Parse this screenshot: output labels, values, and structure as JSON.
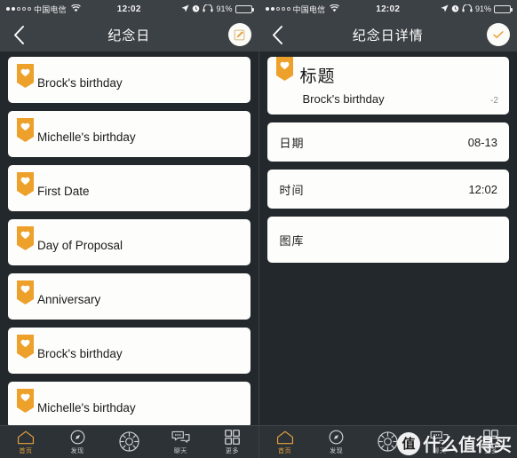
{
  "colors": {
    "background": "#23282c",
    "bar": "#3c4146",
    "card": "#fdfdfb",
    "accent": "#eda02a",
    "tabbar": "#2d3237",
    "tab_active": "#e8a33d"
  },
  "status_bar": {
    "carrier": "中国电信",
    "wifi_icon": "wifi-icon",
    "time": "12:02",
    "location_icon": "location-arrow-icon",
    "alarm_icon": "alarm-clock-icon",
    "headphones_icon": "headphones-icon",
    "battery_percent": "91%",
    "battery_icon": "battery-icon"
  },
  "left_screen": {
    "nav": {
      "back_icon": "chevron-left-icon",
      "title": "纪念日",
      "action_icon": "edit-pencil-icon"
    },
    "list_items": [
      {
        "badge_icon": "heart-ribbon-icon",
        "label": "Brock's birthday"
      },
      {
        "badge_icon": "heart-ribbon-icon",
        "label": "Michelle's birthday"
      },
      {
        "badge_icon": "heart-ribbon-icon",
        "label": "First Date"
      },
      {
        "badge_icon": "heart-ribbon-icon",
        "label": "Day of Proposal"
      },
      {
        "badge_icon": "heart-ribbon-icon",
        "label": "Anniversary"
      },
      {
        "badge_icon": "heart-ribbon-icon",
        "label": "Brock's birthday"
      },
      {
        "badge_icon": "heart-ribbon-icon",
        "label": "Michelle's birthday"
      }
    ]
  },
  "right_screen": {
    "nav": {
      "back_icon": "chevron-left-icon",
      "title": "纪念日详情",
      "action_icon": "check-icon"
    },
    "title_card": {
      "badge_icon": "heart-ribbon-icon",
      "heading": "标题",
      "value": "Brock's birthday",
      "meta": "-2"
    },
    "fields": [
      {
        "label": "日期",
        "value": "08-13"
      },
      {
        "label": "时间",
        "value": "12:02"
      },
      {
        "label": "图库",
        "value": ""
      }
    ]
  },
  "tabbar": {
    "items": [
      {
        "icon": "home-icon",
        "label": "首页",
        "active": true
      },
      {
        "icon": "compass-icon",
        "label": "发现",
        "active": false
      },
      {
        "icon": "sun-icon",
        "label": "",
        "active": false
      },
      {
        "icon": "chat-bubbles-icon",
        "label": "聊天",
        "active": false
      },
      {
        "icon": "grid-icon",
        "label": "更多",
        "active": false
      }
    ]
  },
  "watermark": {
    "logo_text": "值",
    "text": "什么值得买"
  }
}
